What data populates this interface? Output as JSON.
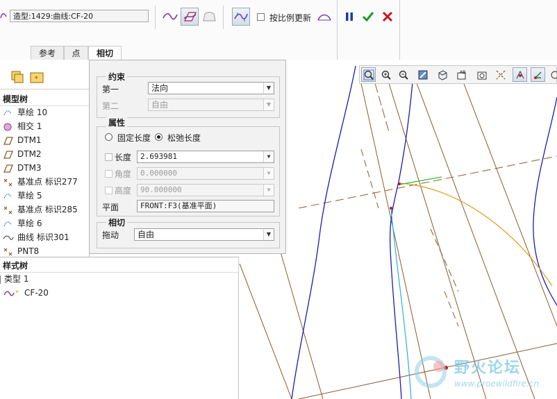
{
  "toolbar": {
    "feature_field": "造型:1429:曲线:CF-20",
    "scale_update_label": "按比例更新",
    "scale_update_checked": false,
    "tabs": [
      {
        "label": "参考",
        "active": false
      },
      {
        "label": "点",
        "active": false
      },
      {
        "label": "相切",
        "active": true
      }
    ],
    "icons": {
      "curve": "free-curve-icon",
      "plane_curve": "plane-curve-icon",
      "surface_curve": "surface-curve-icon",
      "curvature": "curvature-analysis-icon",
      "mirror": "curve-on-surface-icon",
      "pause": "pause-icon",
      "ok": "checkmark-icon",
      "cancel": "close-icon"
    },
    "colors": {
      "ok": "#1a9a2a",
      "cancel": "#c0161c",
      "pause": "#1d3f9a"
    }
  },
  "model_tree": {
    "title": "模型树",
    "items": [
      {
        "label": "草绘 10",
        "icon": "sketch-icon"
      },
      {
        "label": "相交 1",
        "icon": "intersect-icon"
      },
      {
        "label": "DTM1",
        "icon": "datum-plane-icon"
      },
      {
        "label": "DTM2",
        "icon": "datum-plane-icon"
      },
      {
        "label": "DTM3",
        "icon": "datum-plane-icon"
      },
      {
        "label": "基准点 标识277",
        "icon": "datum-point-icon"
      },
      {
        "label": "草绘 5",
        "icon": "sketch-icon"
      },
      {
        "label": "基准点 标识285",
        "icon": "datum-point-icon"
      },
      {
        "label": "草绘 6",
        "icon": "sketch-icon"
      },
      {
        "label": "曲线 标识301",
        "icon": "curve-icon"
      },
      {
        "label": "PNT8",
        "icon": "datum-point-icon"
      }
    ]
  },
  "style_tree": {
    "title": "样式树",
    "items": [
      {
        "label": "类型 1"
      },
      {
        "label": "CF-20"
      }
    ]
  },
  "popup": {
    "constraint": {
      "title": "约束",
      "first_label": "第一",
      "first_value": "法向",
      "second_label": "第二",
      "second_value": "自由"
    },
    "properties": {
      "title": "属性",
      "fixed_length": "固定长度",
      "relaxed_length": "松弛长度",
      "selected": "relaxed",
      "length_label": "长度",
      "length_value": "2.693981",
      "angle_label": "角度",
      "angle_value": "0.000000",
      "height_label": "高度",
      "height_value": "90.000000",
      "plane_label": "平面",
      "plane_value": "FRONT:F3(基准平面)"
    },
    "tangent": {
      "title": "相切",
      "drag_label": "拖动",
      "drag_value": "自由"
    }
  },
  "graphics_toolbar": {
    "icons": [
      "refit-icon",
      "zoom-in-icon",
      "zoom-out-icon",
      "repaint-icon",
      "view-style-icon",
      "saved-views-icon",
      "plane-display-icon",
      "axis-display-icon",
      "point-display-icon",
      "csys-display-icon",
      "annotation-display-icon"
    ]
  },
  "watermark": {
    "text": "野火论坛",
    "url": "www.proewildfire.cn"
  }
}
